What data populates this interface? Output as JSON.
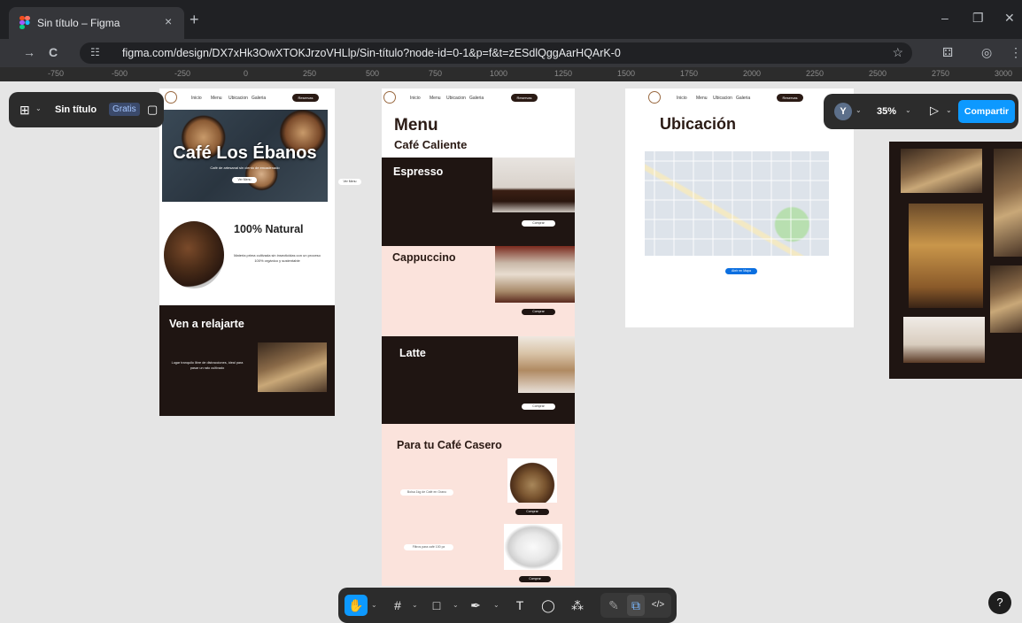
{
  "browser": {
    "tab_title": "Sin título – Figma",
    "tab_close": "×",
    "new_tab": "+",
    "url": "figma.com/design/DX7xHk3OwXTOKJrzoVHLlp/Sin-título?node-id=0-1&p=f&t=zESdlQggAarHQArK-0",
    "back": "←",
    "forward": "→",
    "reload": "C",
    "site_info": "☷",
    "bookmark": "☆",
    "extensions": "⚃",
    "profile": "◎",
    "menu": "⋮",
    "minimize": "–",
    "restore": "❐",
    "close": "✕"
  },
  "ruler": {
    "ticks": [
      "-750",
      "-500",
      "-250",
      "0",
      "250",
      "500",
      "750",
      "1000",
      "1250",
      "1500",
      "1750",
      "2000",
      "2250",
      "2500",
      "2750",
      "3000"
    ]
  },
  "figma": {
    "logo": "⊞",
    "logo_caret": "⌄",
    "file_name": "Sin título",
    "plan_badge": "Gratis",
    "layout_icon": "▢",
    "avatar_letter": "Y",
    "caret": "⌄",
    "zoom": "35%",
    "present_icon": "▷",
    "share_label": "Compartir",
    "help": "?"
  },
  "toolbar": {
    "hand": "✋",
    "frame": "#",
    "shape": "□",
    "pen": "✒",
    "text": "T",
    "comment": "◯",
    "actions": "⁂",
    "draw": "✎",
    "dev": "⧉",
    "code": "</>",
    "caret": "⌄"
  },
  "home_page": {
    "nav": {
      "links": [
        "Inicio",
        "Menu",
        "Ubicacion",
        "Galeria"
      ],
      "button": "Reservas"
    },
    "hero_title": "Café Los Ébanos",
    "hero_subtitle": "Café de artesanal sin ciento de encadenado",
    "hero_button": "Ver Menu",
    "outside_button": "Ver Menu",
    "natural_title": "100% Natural",
    "natural_text": "Materia prima cultivada sin insecticidas con un proceso 100% orgánico y sustentable",
    "relax_title": "Ven a relajarte",
    "relax_text": "Lugar tranquilo libre de distracciones, ideal para pasar un rato cultivado"
  },
  "menu_page": {
    "nav": {
      "links": [
        "Inicio",
        "Menu",
        "Ubicacion",
        "Galeria"
      ],
      "button": "Reservas"
    },
    "title": "Menu",
    "subtitle": "Café Caliente",
    "items": [
      {
        "name": "Espresso",
        "button": "Comprar"
      },
      {
        "name": "Cappuccino",
        "button": "Comprar"
      },
      {
        "name": "Latte",
        "button": "Comprar"
      }
    ],
    "home_title": "Para tu Café Casero",
    "products": [
      {
        "name": "Bolsa 1kg de Café en Grano",
        "button": "Comprar"
      },
      {
        "name": "Filtros para café 100 pz",
        "button": "Comprar"
      }
    ]
  },
  "location_page": {
    "nav": {
      "links": [
        "Inicio",
        "Menu",
        "Ubicacion",
        "Galeria"
      ],
      "button": "Reservas"
    },
    "title": "Ubicación",
    "map_button": "Abrir en Mapa"
  }
}
